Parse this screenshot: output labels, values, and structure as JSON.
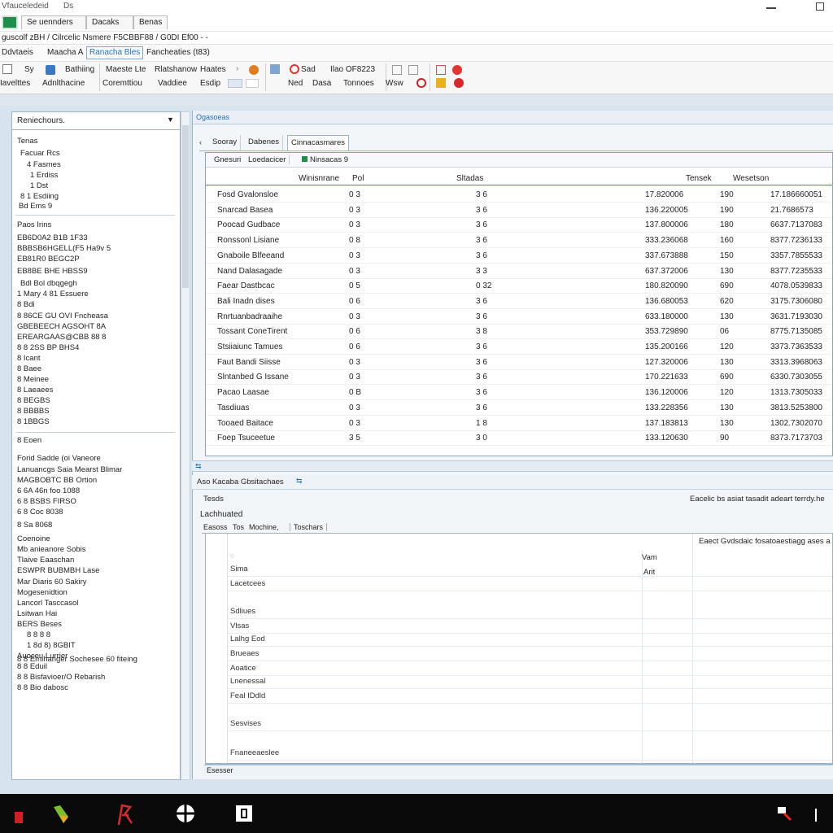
{
  "titlebar": {
    "app_title": "Vfauceledeid",
    "extra": "Ds"
  },
  "tabs": [
    "Se uennders",
    "Dacaks",
    "Benas"
  ],
  "address": "guscolf zBH / Cilrcelic Nsmere F5CBBF88 / G0DI Ef00 - -",
  "menu": [
    "Ddvtaeis",
    "Maacha A",
    "Ranacha Bles",
    "Fancheaties (t83)"
  ],
  "ribbon": {
    "row1": [
      "Sy",
      "Bathiing",
      "Maeste Lte",
      "Rlatshanow",
      "Haates",
      "Sad",
      "Ilao OF8223"
    ],
    "row2": [
      "Iavelttes",
      "Adnlthacine",
      "Coremttiou",
      "Vaddiee",
      "Esdip",
      "Ned",
      "Dasa",
      "Tonnoes",
      "Wsw"
    ]
  },
  "left_panel": {
    "header": "Reniechours.",
    "items": [
      "Tenas",
      "Facuar Rcs",
      "4  Fasmes",
      "1  Erdiss",
      "1  Dst",
      "8  1 Esdiing",
      "Bd  Ems  9",
      "Paos Irins",
      "EB6D0A2  B1B 1F33",
      "BBBSB6HGELL(F5 Ha9v 5",
      "EB81R0 BEGC2P",
      "EB8BE BHE HBSS9",
      "Bdl Bol dbqgegh",
      "1 Mary  4  81 Essuere",
      "8  Bdi",
      "8  86CE  GU  OVI Fncheasa",
      "GBEBEECH AGSOHT 8A",
      "EREARGAAS@CBB 88 8",
      "8  8 2SS  BP  BHS4",
      "8  Icant",
      "8  Baee",
      "8  Meinee",
      "8  Laeaees",
      "8  BEGBS",
      "8  BBBBS",
      "8  1BBGS",
      "8  Eoen",
      "Forid Sadde (oi Vaneore",
      "Lanuancgs Saia Mearst Blimar",
      "MAGBOBTC BB Ortion",
      "6 6A 46n foo 1088",
      "6 8  BSBS FIRSO",
      "6 8  Coc 8038",
      "8  Sa 8068",
      "Coenoine",
      "Mb anieanore Sobis",
      "Tlaive Eaaschan",
      "ESWPR BUBMBH Lase",
      "Mar Diaris 60 Sakiry",
      "Mogesenidtion",
      "Lancorl Tasccasol",
      "Lsitwan Hai",
      "BERS Beses",
      "8  8  8  8",
      "1  8d  8)  8GBIT",
      "Auoceu Lurrier",
      "8  8  Eduil",
      "8  8  Bisfavioer/O Rebarish",
      "8  8  Bio dabosc",
      "8  8  Emihanger Sochesee 60 fiteing"
    ]
  },
  "main": {
    "section_title": "Ogasoeas",
    "subtabs": [
      "Sooray",
      "Dabenes",
      "Cinnacasmares"
    ],
    "grid_tabs": [
      "Gnesuri",
      "Loedacicer",
      "Ninsacas 9"
    ],
    "grid_header": [
      "Winisnrane",
      "Pol",
      "Sltadas",
      "Tensek",
      "Wesetson"
    ],
    "rows": [
      {
        "name": "Fosd Gvalonsloe",
        "a": "0 3",
        "b": "3 6",
        "v1": "17.820006",
        "v2": "190",
        "v3": "17.186660051"
      },
      {
        "name": "Snarcad Basea",
        "a": "0 3",
        "b": "3 6",
        "v1": "136.220005",
        "v2": "190",
        "v3": "21.7686573"
      },
      {
        "name": "Poocad Gudbace",
        "a": "0 3",
        "b": "3 6",
        "v1": "137.800006",
        "v2": "180",
        "v3": "6637.7137083"
      },
      {
        "name": "Ronssonl Lisiane",
        "a": "0 8",
        "b": "3 6",
        "v1": "333.236068",
        "v2": "160",
        "v3": "8377.7236133"
      },
      {
        "name": "Gnaboile Blfeeand",
        "a": "0 3",
        "b": "3 6",
        "v1": "337.673888",
        "v2": "150",
        "v3": "3357.7855533"
      },
      {
        "name": "Nand Dalasagade",
        "a": "0 3",
        "b": "3 3",
        "v1": "637.372006",
        "v2": "130",
        "v3": "8377.7235533"
      },
      {
        "name": "Faear Dastbcac",
        "a": "0 5",
        "b": "0 32",
        "v1": "180.820090",
        "v2": "690",
        "v3": "4078.0539833"
      },
      {
        "name": "Bali Inadn dises",
        "a": "0 6",
        "b": "3 6",
        "v1": "136.680053",
        "v2": "620",
        "v3": "3175.7306080"
      },
      {
        "name": "Rnrtuanbadraaihe",
        "a": "0 3",
        "b": "3 6",
        "v1": "633.180000",
        "v2": "130",
        "v3": "3631.7193030"
      },
      {
        "name": "Tossant ConeTirent",
        "a": "0 6",
        "b": "3 8",
        "v1": "353.729890",
        "v2": "06",
        "v3": "8775.7135085"
      },
      {
        "name": "Stsiiaiunc Tamues",
        "a": "0 6",
        "b": "3 6",
        "v1": "135.200166",
        "v2": "120",
        "v3": "3373.7363533"
      },
      {
        "name": "Faut Bandi Siisse",
        "a": "0 3",
        "b": "3 6",
        "v1": "127.320006",
        "v2": "130",
        "v3": "3313.3968063"
      },
      {
        "name": "Slntanbed G Issane",
        "a": "0 3",
        "b": "3 6",
        "v1": "170.221633",
        "v2": "690",
        "v3": "6330.7303055"
      },
      {
        "name": "Pacao Laasae",
        "a": "0 B",
        "b": "3 6",
        "v1": "136.120006",
        "v2": "120",
        "v3": "1313.7305033"
      },
      {
        "name": "Tasdiuas",
        "a": "0 3",
        "b": "3 6",
        "v1": "133.228356",
        "v2": "130",
        "v3": "3813.5253800"
      },
      {
        "name": "Tooaed Baitace",
        "a": "0 3",
        "b": "1 8",
        "v1": "137.183813",
        "v2": "130",
        "v3": "1302.7302070"
      },
      {
        "name": "Foep Tsuceetue",
        "a": "3 5",
        "b": "3 0",
        "v1": "133.120630",
        "v2": "90",
        "v3": "8373.7173703"
      }
    ],
    "detail": {
      "title": "Aso Kacaba Gbsitachaes",
      "label1": "Tesds",
      "label2": "Lachhuated",
      "right_text": "Eacelic bs asiat tasadit adeart terrdy.he",
      "tabs": [
        "Easoss",
        "Tos",
        "Mochine,",
        "Toschars"
      ],
      "col_header_right": "Eaect Gvdsdaic fosatoaestiagg ases a",
      "col_vam": "Vam",
      "col_arit": "Arit",
      "fields": [
        "Sima",
        "Lacetcees",
        "Sdliues",
        "Vlsas",
        "Lalhg Eod",
        "Brueaes",
        "Aoatice",
        "Lnenessal",
        "Feal IDdld",
        "Sesvises",
        "Fnaneeaeslee"
      ],
      "footer": "Esesser"
    }
  },
  "colors": {
    "accent": "#2a6fb5",
    "panel_border": "#9bb2cc",
    "workspace": "#d7e3ef",
    "taskbar": "#0a0a0a"
  },
  "taskbar_icons": [
    "red-app-icon",
    "green-app-icon",
    "red-glyph-icon",
    "white-pinwheel-icon",
    "white-frame-icon",
    "tray-network-icon",
    "tray-speaker-icon"
  ]
}
